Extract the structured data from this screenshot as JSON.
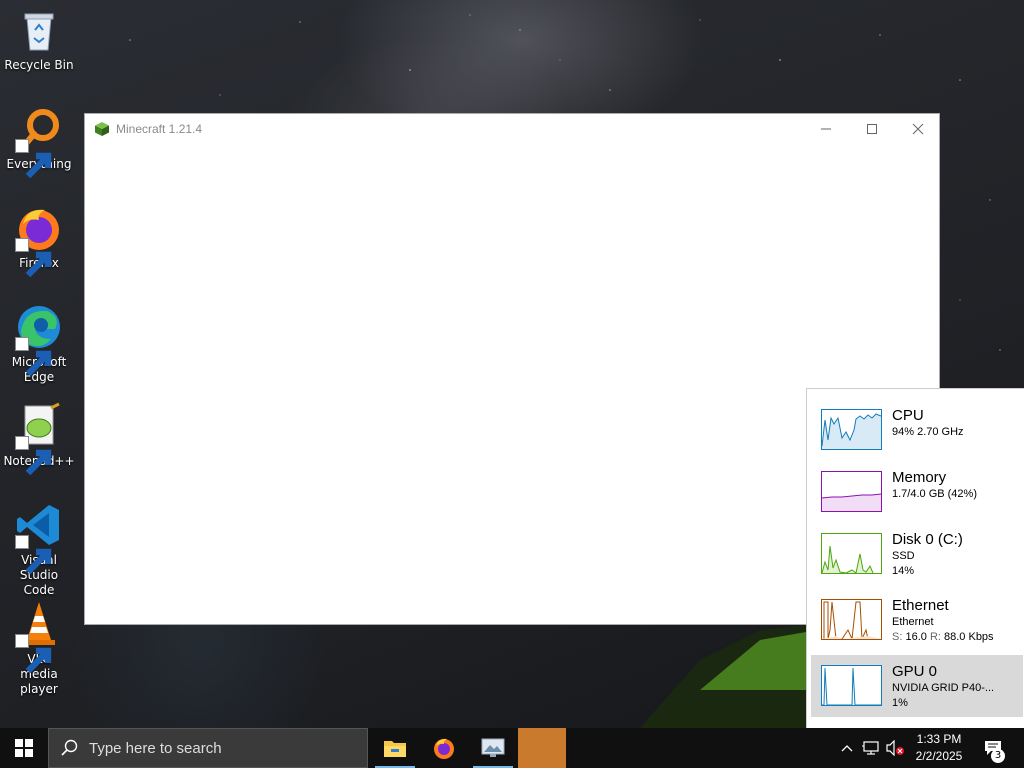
{
  "desktop": {
    "icons": [
      {
        "label": "Recycle Bin"
      },
      {
        "label": "Everything"
      },
      {
        "label": "Firefox"
      },
      {
        "label": "Microsoft Edge"
      },
      {
        "label": "Notepad++"
      },
      {
        "label": "Visual Studio Code"
      },
      {
        "label": "VLC media player"
      }
    ]
  },
  "window": {
    "title": "Minecraft 1.21.4"
  },
  "perf": {
    "cpu": {
      "title": "CPU",
      "line1": "94%  2.70 GHz",
      "color": "#117dbb"
    },
    "memory": {
      "title": "Memory",
      "line1": "1.7/4.0 GB (42%)",
      "color": "#8b12ae"
    },
    "disk": {
      "title": "Disk 0 (C:)",
      "line1": "SSD",
      "line2": "14%",
      "color": "#4da60c"
    },
    "ethernet": {
      "title": "Ethernet",
      "line1": "Ethernet",
      "send_label": "S:",
      "send": "16.0",
      "recv_label": "R:",
      "recv": "88.0 Kbps",
      "color": "#a74f01"
    },
    "gpu": {
      "title": "GPU 0",
      "line1": "NVIDIA GRID P40-...",
      "line2": "1%",
      "color": "#117dbb"
    }
  },
  "taskbar": {
    "search_placeholder": "Type here to search",
    "time": "1:33 PM",
    "date": "2/2/2025",
    "notifications": "3"
  }
}
